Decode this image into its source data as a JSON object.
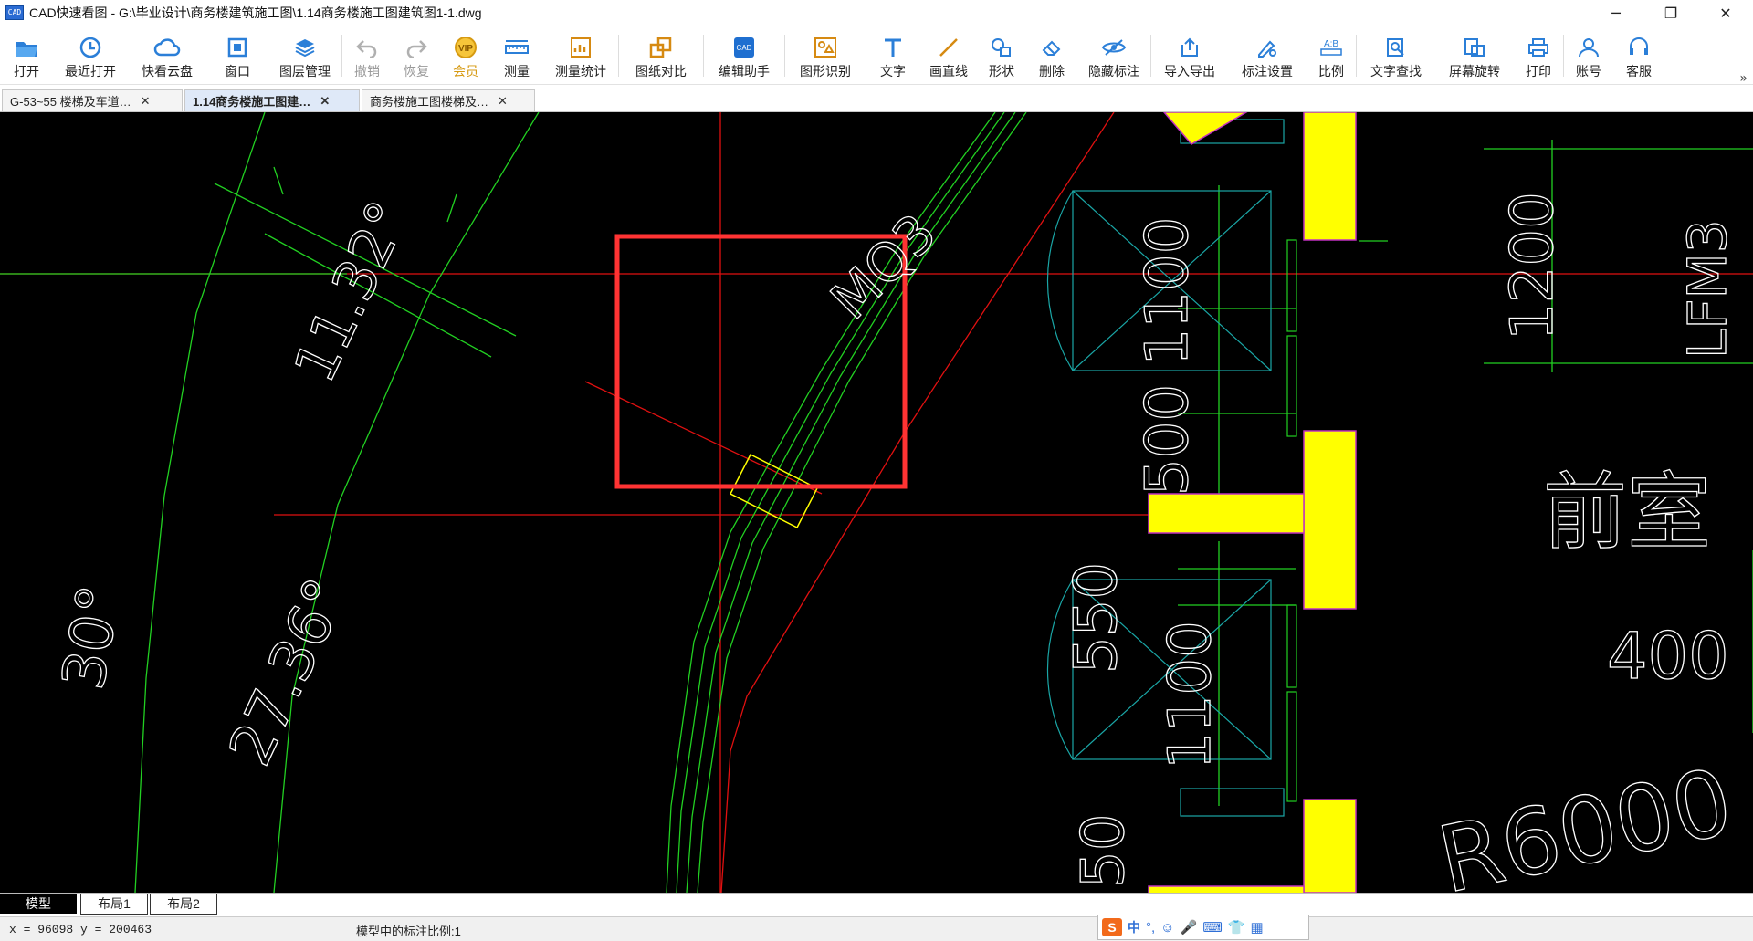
{
  "window": {
    "title": "CAD快速看图 - G:\\毕业设计\\商务楼建筑施工图\\1.14商务楼施工图建筑图1-1.dwg",
    "logo_text": "CAD",
    "minimize": "─",
    "restore": "❐",
    "close": "✕"
  },
  "toolbar": {
    "items": [
      {
        "label": "打开",
        "icon": "open-folder-icon"
      },
      {
        "label": "最近打开",
        "icon": "recent-clock-icon"
      },
      {
        "label": "快看云盘",
        "icon": "cloud-icon"
      },
      {
        "label": "窗口",
        "icon": "window-icon"
      },
      {
        "label": "图层管理",
        "icon": "layers-icon"
      },
      {
        "label": "撤销",
        "icon": "undo-icon"
      },
      {
        "label": "恢复",
        "icon": "redo-icon"
      },
      {
        "label": "会员",
        "icon": "vip-icon"
      },
      {
        "label": "测量",
        "icon": "ruler-icon"
      },
      {
        "label": "测量统计",
        "icon": "measure-stats-icon"
      },
      {
        "label": "图纸对比",
        "icon": "compare-icon"
      },
      {
        "label": "编辑助手",
        "icon": "edit-assistant-icon"
      },
      {
        "label": "图形识别",
        "icon": "shape-recognition-icon"
      },
      {
        "label": "文字",
        "icon": "text-icon"
      },
      {
        "label": "画直线",
        "icon": "line-icon"
      },
      {
        "label": "形状",
        "icon": "shapes-icon"
      },
      {
        "label": "删除",
        "icon": "eraser-icon"
      },
      {
        "label": "隐藏标注",
        "icon": "hide-eye-icon"
      },
      {
        "label": "导入导出",
        "icon": "import-export-icon"
      },
      {
        "label": "标注设置",
        "icon": "annotation-settings-icon"
      },
      {
        "label": "比例",
        "icon": "scale-icon"
      },
      {
        "label": "文字查找",
        "icon": "text-search-icon"
      },
      {
        "label": "屏幕旋转",
        "icon": "screen-rotate-icon"
      },
      {
        "label": "打印",
        "icon": "printer-icon"
      },
      {
        "label": "账号",
        "icon": "account-icon"
      },
      {
        "label": "客服",
        "icon": "headset-icon"
      }
    ],
    "vip_badge": "VIP",
    "scale_icon_text": "A:B",
    "overflow": "»"
  },
  "tabs": [
    {
      "label": "G-53~55 楼梯及车道…",
      "close": "✕"
    },
    {
      "label": "1.14商务楼施工图建…",
      "close": "✕"
    },
    {
      "label": "商务楼施工图楼梯及…",
      "close": "✕"
    }
  ],
  "drawing": {
    "texts": {
      "angle_1": "11.32°",
      "mq3": "MQ3",
      "angle_2": "27.36°",
      "angle_3": "30°",
      "dim_5001100": "500 1100",
      "dim_1200": "1200",
      "lfm3": "LFM3",
      "room": "前室",
      "dim_550": "550",
      "dim_1100": "1100",
      "dim_400": "400",
      "radius": "R6000",
      "dim_50": "50"
    },
    "colors": {
      "background": "#000000",
      "green": "#22d022",
      "red": "#e01010",
      "yellow": "#ffff00",
      "cyan": "#1aa6a6",
      "white": "#ffffff",
      "highlight": "#ff3333"
    }
  },
  "layout_tabs": [
    "模型",
    "布局1",
    "布局2"
  ],
  "status": {
    "coords": "x = 96098  y = 200463",
    "scale_text": "模型中的标注比例:1"
  },
  "ime": {
    "logo": "S",
    "lang": "中",
    "punct": "°,",
    "emoji": "☺",
    "mic": "🎤",
    "keyboard": "⌨",
    "user": "👕",
    "grid": "▦"
  }
}
